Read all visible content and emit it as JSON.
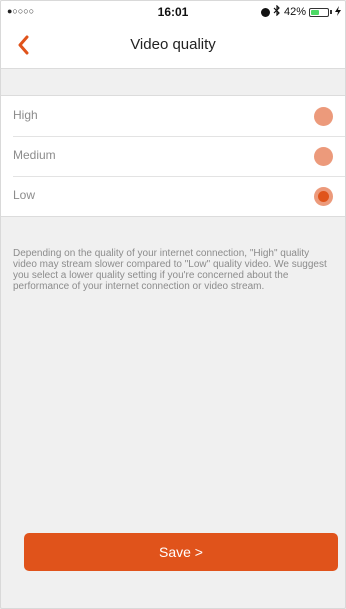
{
  "status_bar": {
    "signal": "●○○○○",
    "time": "16:01",
    "battery_percent": "42%",
    "battery_level": 0.42,
    "bluetooth_symbol": "∗",
    "charging_symbol": "ϟ"
  },
  "nav": {
    "title": "Video quality"
  },
  "options": [
    {
      "label": "High",
      "selected": false
    },
    {
      "label": "Medium",
      "selected": false
    },
    {
      "label": "Low",
      "selected": true
    }
  ],
  "description": "Depending on the quality of your internet connection, \"High\" quality video may stream slower compared to \"Low\" quality video. We suggest you select a lower quality setting if you're concerned about the performance of your internet connection or video stream.",
  "save_button": {
    "label": "Save >"
  },
  "colors": {
    "accent": "#e0531b",
    "radio_unselected": "#ec9a7b"
  }
}
